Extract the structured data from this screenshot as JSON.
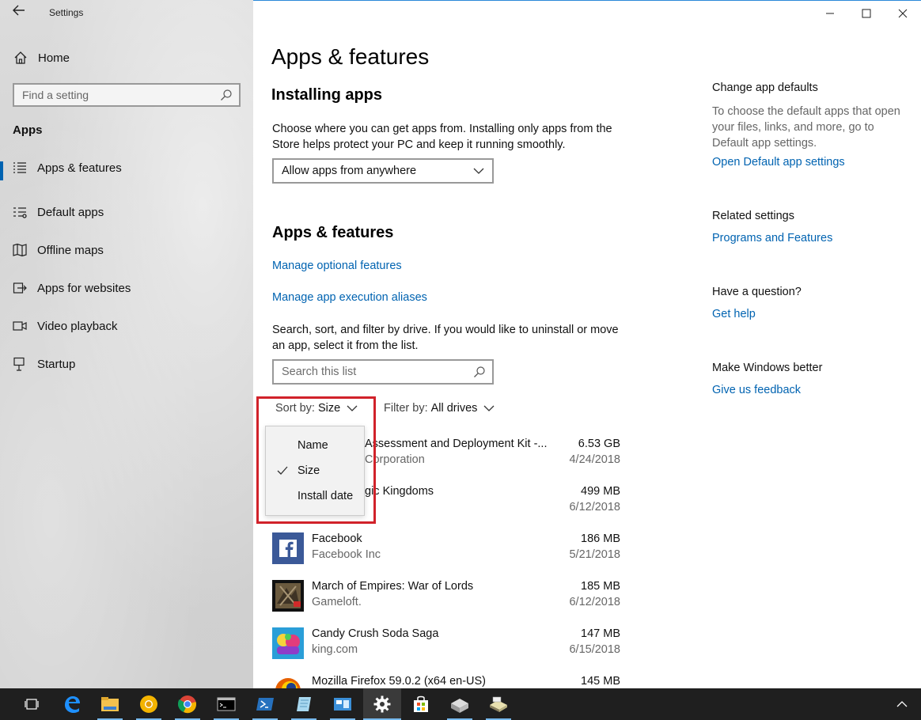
{
  "window": {
    "title": "Settings",
    "minimize_label": "",
    "maximize_label": "",
    "close_label": ""
  },
  "sidebar": {
    "home_label": "Home",
    "search_placeholder": "Find a setting",
    "section_label": "Apps",
    "items": [
      {
        "label": "Apps & features",
        "icon": "list-icon",
        "active": true
      },
      {
        "label": "Default apps",
        "icon": "default-apps-icon"
      },
      {
        "label": "Offline maps",
        "icon": "map-icon"
      },
      {
        "label": "Apps for websites",
        "icon": "link-window-icon"
      },
      {
        "label": "Video playback",
        "icon": "video-icon"
      },
      {
        "label": "Startup",
        "icon": "startup-icon"
      }
    ]
  },
  "main": {
    "page_title": "Apps & features",
    "installing": {
      "heading": "Installing apps",
      "description": "Choose where you can get apps from. Installing only apps from the Store helps protect your PC and keep it running smoothly.",
      "dropdown_value": "Allow apps from anywhere"
    },
    "features": {
      "heading": "Apps & features",
      "link_optional": "Manage optional features",
      "link_aliases": "Manage app execution aliases",
      "description": "Search, sort, and filter by drive. If you would like to uninstall or move an app, select it from the list.",
      "search_placeholder": "Search this list",
      "sort_label": "Sort by:",
      "sort_value": "Size",
      "filter_label": "Filter by:",
      "filter_value": "All drives"
    },
    "sort_menu": {
      "options": [
        "Name",
        "Size",
        "Install date"
      ],
      "selected": "Size"
    },
    "apps": [
      {
        "name": "Assessment and Deployment Kit -...",
        "publisher": "Corporation",
        "size": "6.53 GB",
        "date": "4/24/2018"
      },
      {
        "name": "gic Kingdoms",
        "publisher": "",
        "size": "499 MB",
        "date": "6/12/2018"
      },
      {
        "name": "Facebook",
        "publisher": "Facebook Inc",
        "size": "186 MB",
        "date": "5/21/2018"
      },
      {
        "name": "March of Empires: War of Lords",
        "publisher": "Gameloft.",
        "size": "185 MB",
        "date": "6/12/2018"
      },
      {
        "name": "Candy Crush Soda Saga",
        "publisher": "king.com",
        "size": "147 MB",
        "date": "6/15/2018"
      },
      {
        "name": "Mozilla Firefox 59.0.2 (x64 en-US)",
        "publisher": "",
        "size": "145 MB",
        "date": ""
      }
    ]
  },
  "right": {
    "defaults_heading": "Change app defaults",
    "defaults_text": "To choose the default apps that open your files, links, and more, go to Default app settings.",
    "defaults_link": "Open Default app settings",
    "related_heading": "Related settings",
    "related_link": "Programs and Features",
    "question_heading": "Have a question?",
    "question_link": "Get help",
    "better_heading": "Make Windows better",
    "better_link": "Give us feedback"
  },
  "colors": {
    "accent": "#0063b1",
    "highlight_box": "#d1222a",
    "taskbar": "#1f1f1f"
  },
  "taskbar": {
    "items": [
      "task-view-icon",
      "edge-icon",
      "file-explorer-icon",
      "chrome-canary-icon",
      "chrome-icon",
      "command-prompt-icon",
      "powershell-icon",
      "notepad-icon",
      "control-panel-icon",
      "settings-icon",
      "store-icon",
      "installer-icon",
      "disk-icon"
    ],
    "active": "settings-icon"
  }
}
